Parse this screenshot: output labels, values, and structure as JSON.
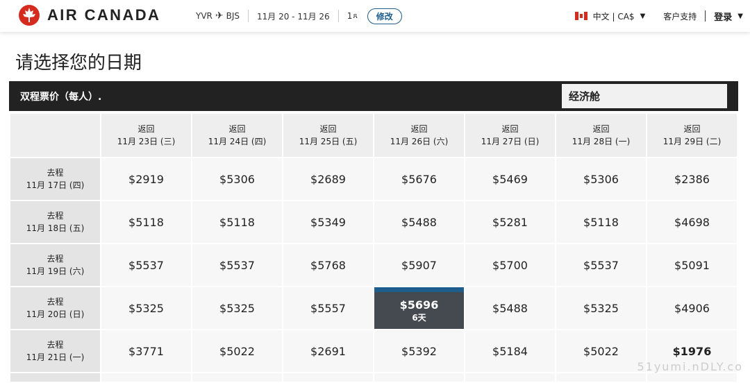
{
  "header": {
    "brand": "AIR CANADA",
    "origin": "YVR",
    "destination": "BJS",
    "dates": "11月 20 - 11月 26",
    "passengers": "1",
    "modify": "修改",
    "lang": "中文 | CA$",
    "support": "客户支持",
    "login": "登录"
  },
  "page_title": "请选择您的日期",
  "grid_header": {
    "title": "双程票价（每人）.",
    "cabin": "经济舱"
  },
  "columns": [
    {
      "label": "返回",
      "date": "11月 23日 (三)"
    },
    {
      "label": "返回",
      "date": "11月 24日 (四)"
    },
    {
      "label": "返回",
      "date": "11月 25日 (五)"
    },
    {
      "label": "返回",
      "date": "11月 26日 (六)"
    },
    {
      "label": "返回",
      "date": "11月 27日 (日)"
    },
    {
      "label": "返回",
      "date": "11月 28日 (一)"
    },
    {
      "label": "返回",
      "date": "11月 29日 (二)"
    }
  ],
  "rows": [
    {
      "label": "去程",
      "date": "11月 17日 (四)",
      "prices": [
        "$2919",
        "$5306",
        "$2689",
        "$5676",
        "$5469",
        "$5306",
        "$2386"
      ]
    },
    {
      "label": "去程",
      "date": "11月 18日 (五)",
      "prices": [
        "$5118",
        "$5118",
        "$5349",
        "$5488",
        "$5281",
        "$5118",
        "$4698"
      ]
    },
    {
      "label": "去程",
      "date": "11月 19日 (六)",
      "prices": [
        "$5537",
        "$5537",
        "$5768",
        "$5907",
        "$5700",
        "$5537",
        "$5091"
      ]
    },
    {
      "label": "去程",
      "date": "11月 20日 (日)",
      "prices": [
        "$5325",
        "$5325",
        "$5557",
        "$5696",
        "$5488",
        "$5325",
        "$4906"
      ],
      "selected_sub": "6天"
    },
    {
      "label": "去程",
      "date": "11月 21日 (一)",
      "prices": [
        "$3771",
        "$5022",
        "$2691",
        "$5392",
        "$5184",
        "$5022",
        "$1976"
      ]
    }
  ],
  "colors": {
    "selected": "#454a51",
    "accent": "#1f5d8c",
    "brand_red": "#d52b1e"
  },
  "watermark": "51yumi.nDLY.co"
}
